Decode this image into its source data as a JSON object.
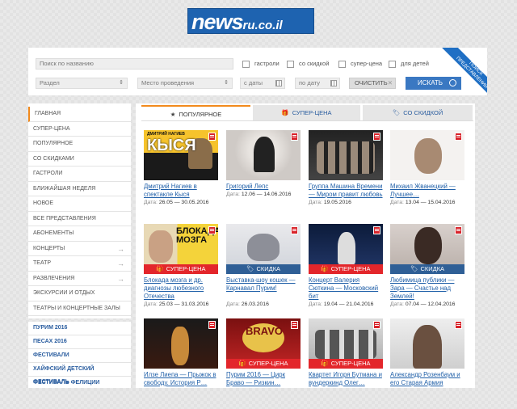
{
  "logo": {
    "main": "news",
    "domain": "ru.co.il"
  },
  "search": {
    "name_placeholder": "Поиск по названию",
    "checkboxes": [
      "гастроли",
      "со скидкой",
      "супер-цена",
      "для детей"
    ],
    "section": "Раздел",
    "venue": "Место проведения",
    "date_from": "с даты",
    "date_to": "по дату",
    "clear": "ОЧИСТИТЬ",
    "submit": "ИСКАТЬ",
    "advanced": "ПОИСК\nПРЕДСТАВЛЕНИЙ"
  },
  "sidebar": {
    "items": [
      {
        "label": "ГЛАВНАЯ",
        "arrow": false
      },
      {
        "label": "СУПЕР-ЦЕНА",
        "arrow": false
      },
      {
        "label": "ПОПУЛЯРНОЕ",
        "arrow": false
      },
      {
        "label": "СО СКИДКАМИ",
        "arrow": false
      },
      {
        "label": "ГАСТРОЛИ",
        "arrow": false
      },
      {
        "label": "БЛИЖАЙШАЯ НЕДЕЛЯ",
        "arrow": false
      },
      {
        "label": "НОВОЕ",
        "arrow": false
      },
      {
        "label": "ВСЕ ПРЕДСТАВЛЕНИЯ",
        "arrow": false
      },
      {
        "label": "АБОНЕМЕНТЫ",
        "arrow": false
      },
      {
        "label": "КОНЦЕРТЫ",
        "arrow": true
      },
      {
        "label": "ТЕАТР",
        "arrow": true
      },
      {
        "label": "РАЗВЛЕЧЕНИЯ",
        "arrow": true
      },
      {
        "label": "ЭКСКУРСИИ И ОТДЫХ",
        "arrow": false
      },
      {
        "label": "ТЕАТРЫ И КОНЦЕРТНЫЕ ЗАЛЫ",
        "arrow": false
      }
    ],
    "arrow_glyph": "→"
  },
  "festivals": [
    "ПУРИМ 2016",
    "ПЕСАХ 2016",
    "ФЕСТИВАЛИ",
    "ХАЙФСКИЙ ДЕТСКИЙ ФЕСТИВАЛЬ",
    "ФЕСТИВАЛЬ ФЕЛИЦИИ"
  ],
  "tabs": [
    {
      "label": "ПОПУЛЯРНОЕ",
      "icon": "star-icon",
      "glyph": "★"
    },
    {
      "label": "СУПЕР-ЦЕНА",
      "icon": "gift-icon",
      "glyph": "🎁"
    },
    {
      "label": "СО СКИДКОЙ",
      "icon": "tag-icon",
      "glyph": "🏷"
    }
  ],
  "date_label": "Дата:",
  "ribbons": {
    "super": "СУПЕР-ЦЕНА",
    "discount": "СКИДКА"
  },
  "cards": [
    {
      "title": "Дмитрий Нагиев в спектакле Кыся",
      "date": "26.05 — 30.05.2016",
      "ribbon": "",
      "thumb": "kysya",
      "poster_text": "КЫСЯ",
      "poster_sub": "ДМИТРИЙ НАГИЕВ"
    },
    {
      "title": "Григорий Лепс",
      "date": "12.06 — 14.06.2016",
      "ribbon": "",
      "thumb": "leps"
    },
    {
      "title": "Группа Машина Времени — Миром правит любовь",
      "date": "19.05.2016",
      "ribbon": "",
      "thumb": "band"
    },
    {
      "title": "Михаил Жванецкий — Лучшее…",
      "date": "13.04 — 15.04.2016",
      "ribbon": "",
      "thumb": "zhvanetsky"
    },
    {
      "title": "Блокада мозга и др. диагнозы любезного Отечества",
      "date": "25.03 — 31.03.2016",
      "ribbon": "super",
      "thumb": "blokada",
      "poster_text": "БЛОКАДА МОЗГА"
    },
    {
      "title": "Выставка-шоу кошек — Карнавал Пурим!",
      "date": "26.03.2016",
      "ribbon": "discount",
      "thumb": "cat"
    },
    {
      "title": "Концерт Валерия Сюткина — Московский бит",
      "date": "19.04 — 21.04.2016",
      "ribbon": "super",
      "thumb": "syutkin"
    },
    {
      "title": "Любимица публики — Зара — Счастье над Землей!",
      "date": "07.04 — 12.04.2016",
      "ribbon": "discount",
      "thumb": "zara"
    },
    {
      "title": "Илзе Лиепа — Прыжок в свободу. История Р…",
      "date": "",
      "ribbon": "",
      "thumb": "liepa"
    },
    {
      "title": "Пурим 2016 — Цирк Браво — Ризкин…",
      "date": "",
      "ribbon": "super",
      "thumb": "bravo",
      "poster_text": "BRAVO"
    },
    {
      "title": "Квартет Игоря Бутмана и вундеркинд Олег…",
      "date": "",
      "ribbon": "super",
      "thumb": "butman"
    },
    {
      "title": "Александр Розенбаум и его Старая Армия",
      "date": "",
      "ribbon": "",
      "thumb": "rozenbaum"
    }
  ],
  "colors": {
    "accent": "#f28a1c",
    "brand_blue": "#1e63b0",
    "link": "#1f5fa8",
    "super_red": "#e3262b",
    "discount_blue": "#2f5f96"
  }
}
